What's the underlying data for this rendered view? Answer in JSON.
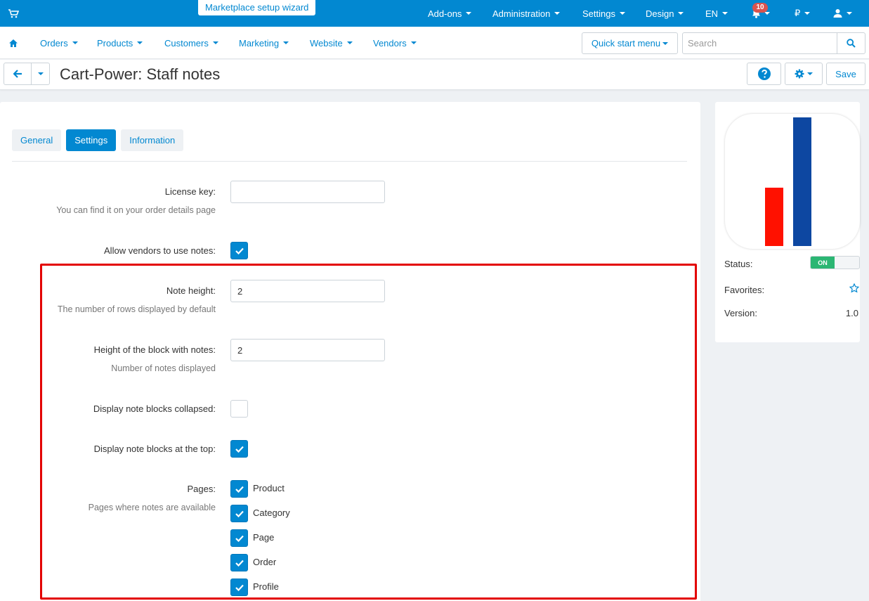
{
  "topbar": {
    "wizard_label": "Marketplace setup wizard",
    "menu": [
      {
        "label": "Add-ons"
      },
      {
        "label": "Administration"
      },
      {
        "label": "Settings"
      },
      {
        "label": "Design"
      },
      {
        "label": "EN"
      }
    ],
    "notifications_count": "10",
    "currency_symbol": "₽",
    "icons": [
      "cart-icon",
      "bell-icon",
      "user-icon"
    ]
  },
  "navbar": {
    "items": [
      {
        "label": "Orders"
      },
      {
        "label": "Products"
      },
      {
        "label": "Customers"
      },
      {
        "label": "Marketing"
      },
      {
        "label": "Website"
      },
      {
        "label": "Vendors"
      }
    ],
    "quick_start_label": "Quick start menu",
    "search_placeholder": "Search"
  },
  "titlebar": {
    "title": "Cart-Power: Staff notes",
    "save_label": "Save"
  },
  "tabs": [
    {
      "label": "General",
      "active": false
    },
    {
      "label": "Settings",
      "active": true
    },
    {
      "label": "Information",
      "active": false
    }
  ],
  "form": {
    "license_key": {
      "label": "License key:",
      "hint": "You can find it on your order details page",
      "value": ""
    },
    "allow_vendors": {
      "label": "Allow vendors to use notes:",
      "checked": true
    },
    "note_height": {
      "label": "Note height:",
      "hint": "The number of rows displayed by default",
      "value": "2"
    },
    "block_height": {
      "label": "Height of the block with notes:",
      "hint": "Number of notes displayed",
      "value": "2"
    },
    "collapsed": {
      "label": "Display note blocks collapsed:",
      "checked": false
    },
    "at_top": {
      "label": "Display note blocks at the top:",
      "checked": true
    },
    "pages": {
      "label": "Pages:",
      "hint": "Pages where notes are available",
      "options": [
        {
          "label": "Product",
          "checked": true
        },
        {
          "label": "Category",
          "checked": true
        },
        {
          "label": "Page",
          "checked": true
        },
        {
          "label": "Order",
          "checked": true
        },
        {
          "label": "Profile",
          "checked": true
        }
      ]
    }
  },
  "sidebar": {
    "status_label": "Status:",
    "status_value": "ON",
    "favorites_label": "Favorites:",
    "version_label": "Version:",
    "version_value": "1.0"
  },
  "colors": {
    "primary": "#0288d1",
    "highlight": "#e30000",
    "status_on": "#2bb673",
    "logo_red": "#ff1100",
    "logo_blue": "#0d47a1"
  }
}
